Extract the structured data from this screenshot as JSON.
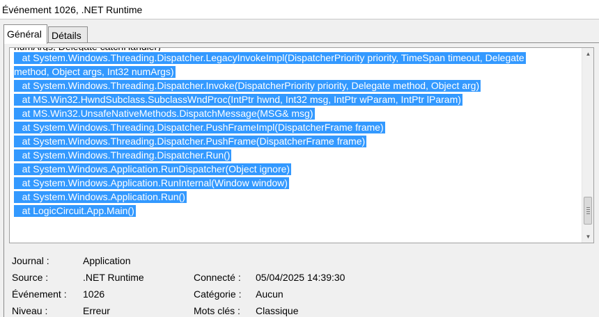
{
  "window": {
    "title": "Événement 1026, .NET Runtime"
  },
  "tabs": [
    {
      "label": "Général",
      "active": true
    },
    {
      "label": "Détails",
      "active": false
    }
  ],
  "description": {
    "partial_top_line": "numArgs, Delegate catchHandler)",
    "selected_lines": [
      "   at System.Windows.Threading.Dispatcher.LegacyInvokeImpl(DispatcherPriority priority, TimeSpan timeout, Delegate",
      "method, Object args, Int32 numArgs)",
      "   at System.Windows.Threading.Dispatcher.Invoke(DispatcherPriority priority, Delegate method, Object arg)",
      "   at MS.Win32.HwndSubclass.SubclassWndProc(IntPtr hwnd, Int32 msg, IntPtr wParam, IntPtr lParam)",
      "   at MS.Win32.UnsafeNativeMethods.DispatchMessage(MSG& msg)",
      "   at System.Windows.Threading.Dispatcher.PushFrameImpl(DispatcherFrame frame)",
      "   at System.Windows.Threading.Dispatcher.PushFrame(DispatcherFrame frame)",
      "   at System.Windows.Threading.Dispatcher.Run()",
      "   at System.Windows.Application.RunDispatcher(Object ignore)",
      "   at System.Windows.Application.RunInternal(Window window)",
      "   at System.Windows.Application.Run()",
      "   at LogicCircuit.App.Main()"
    ],
    "selection_color": "#3399ff"
  },
  "properties": {
    "journal": {
      "label": "Journal :",
      "value": "Application"
    },
    "source": {
      "label": "Source :",
      "value": ".NET Runtime"
    },
    "connecte": {
      "label": "Connecté :",
      "value": "05/04/2025 14:39:30"
    },
    "evenement": {
      "label": "Événement :",
      "value": "1026"
    },
    "categorie": {
      "label": "Catégorie :",
      "value": "Aucun"
    },
    "niveau": {
      "label": "Niveau :",
      "value": "Erreur"
    },
    "motscles": {
      "label": "Mots clés :",
      "value": "Classique"
    }
  }
}
